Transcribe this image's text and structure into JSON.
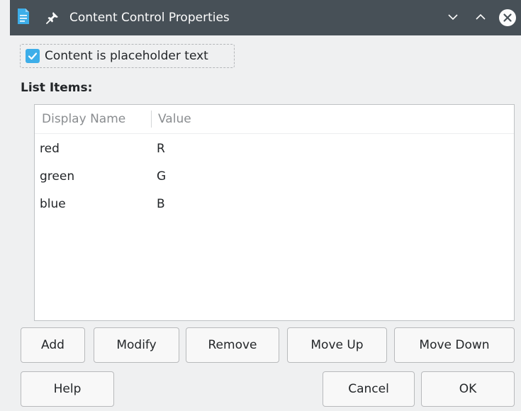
{
  "window": {
    "title": "Content Control Properties"
  },
  "placeholder": {
    "label": "Content is placeholder text",
    "checked": true
  },
  "list": {
    "label": "List Items:",
    "columns": [
      "Display Name",
      "Value"
    ],
    "rows": [
      {
        "name": "red",
        "value": "R"
      },
      {
        "name": "green",
        "value": "G"
      },
      {
        "name": "blue",
        "value": "B"
      }
    ]
  },
  "buttons": {
    "add": "Add",
    "modify": "Modify",
    "remove": "Remove",
    "move_up": "Move Up",
    "move_down": "Move Down",
    "help": "Help",
    "cancel": "Cancel",
    "ok": "OK"
  },
  "colors": {
    "titlebar": "#475057",
    "accent": "#3daee9",
    "app_icon": "#3daee9"
  }
}
